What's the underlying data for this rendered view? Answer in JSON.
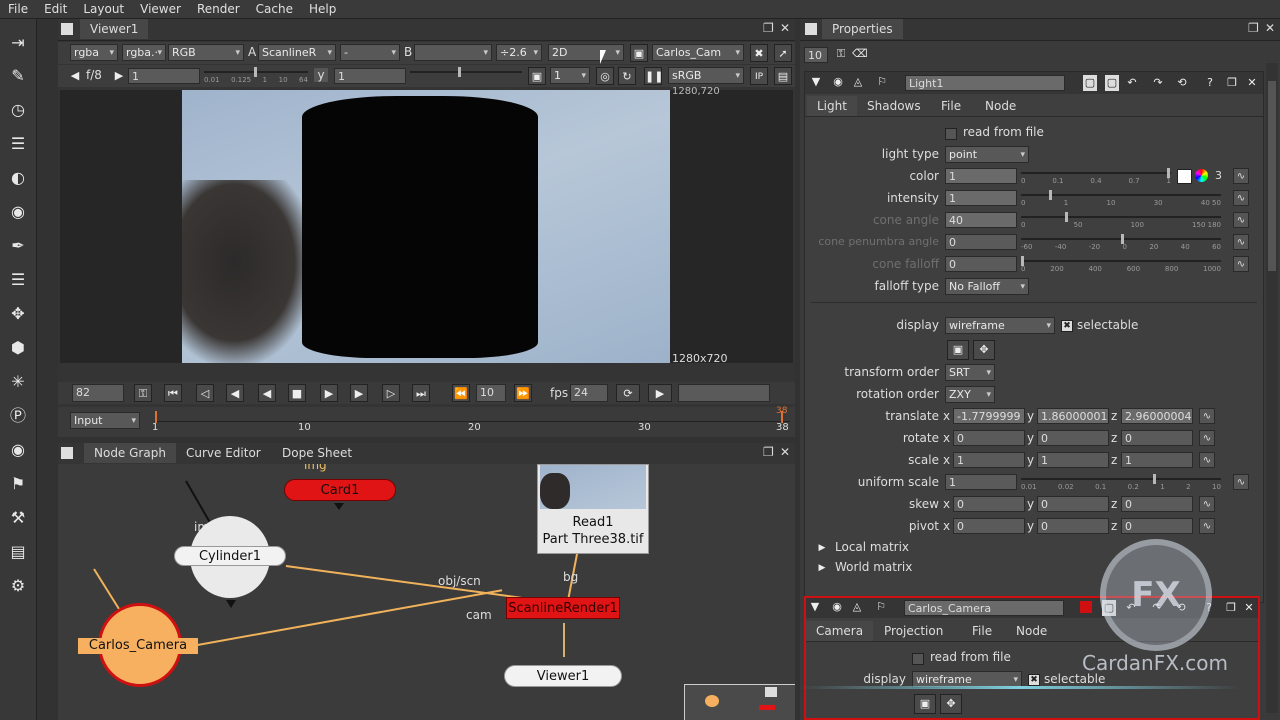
{
  "menu": [
    "File",
    "Edit",
    "Layout",
    "Viewer",
    "Render",
    "Cache",
    "Help"
  ],
  "viewer": {
    "tab": "Viewer1",
    "row1": {
      "channels": "rgba",
      "alpha": "rgba.·",
      "colorspace": "RGB",
      "a_label": "A",
      "a_input": "ScanlineR",
      "wipe": "-",
      "b_label": "B",
      "b_input": "",
      "gain": "÷2.6",
      "mode": "2D",
      "camera": "Carlos_Cam"
    },
    "row2": {
      "fstop": "f/8",
      "gain_value": "1",
      "gain_ticks": [
        "0.01",
        "0.125",
        "1",
        "10",
        "64"
      ],
      "y_label": "y",
      "gamma_value": "1",
      "proxy": "1",
      "lut": "sRGB",
      "ip": "IP"
    },
    "res_top": "1280,720",
    "res_bottom": "1280x720"
  },
  "playback": {
    "frame": "82",
    "step": "10",
    "fps_label": "fps",
    "fps": "24",
    "input": "Input",
    "ruler_start": "1",
    "ruler_labels": [
      "1",
      "10",
      "20",
      "30",
      "38"
    ],
    "ruler_end_top": "38"
  },
  "nodegraph": {
    "tabs": [
      "Node Graph",
      "Curve Editor",
      "Dope Sheet"
    ],
    "nodes": {
      "card": "Card1",
      "cylinder": "Cylinder1",
      "camera": "Carlos_Camera",
      "read": "Read1",
      "read_file": "Part Three38.tif",
      "scanline": "ScanlineRender1",
      "viewer": "Viewer1"
    },
    "edge_labels": {
      "img": "img",
      "obj": "obj/scn",
      "cam": "cam",
      "bg": "bg",
      "img2": "img"
    }
  },
  "properties": {
    "title": "Properties",
    "max_panels": "10",
    "light": {
      "name": "Light1",
      "tabs": [
        "Light",
        "Shadows",
        "File",
        "Node"
      ],
      "read_from_file": "read from file",
      "light_type_label": "light type",
      "light_type": "point",
      "color_label": "color",
      "color": "1",
      "color_ticks": [
        "0",
        "0.1",
        "0.4",
        "0.7",
        "1"
      ],
      "channels": "3",
      "intensity_label": "intensity",
      "intensity": "1",
      "intensity_ticks": [
        "0",
        "1",
        "10",
        "30",
        "40 50"
      ],
      "cone_angle_label": "cone angle",
      "cone_angle": "40",
      "cone_angle_ticks": [
        "0",
        "50",
        "100",
        "150 180"
      ],
      "cone_penumbra_label": "cone penumbra angle",
      "cone_penumbra": "0",
      "cone_penumbra_ticks": [
        "-60",
        "-40",
        "-20",
        "0",
        "20",
        "40",
        "60"
      ],
      "cone_falloff_label": "cone falloff",
      "cone_falloff": "0",
      "cone_falloff_ticks": [
        "0",
        "200",
        "400",
        "600",
        "800",
        "1000"
      ],
      "falloff_type_label": "falloff type",
      "falloff_type": "No Falloff",
      "display_label": "display",
      "display": "wireframe",
      "selectable": "selectable",
      "transform_order_label": "transform order",
      "transform_order": "SRT",
      "rotation_order_label": "rotation order",
      "rotation_order": "ZXY",
      "translate_label": "translate",
      "translate": {
        "x": "-1.7799999",
        "y": "1.86000001",
        "z": "2.96000004"
      },
      "rotate_label": "rotate",
      "rotate": {
        "x": "0",
        "y": "0",
        "z": "0"
      },
      "scale_label": "scale",
      "scale": {
        "x": "1",
        "y": "1",
        "z": "1"
      },
      "uniform_scale_label": "uniform scale",
      "uniform_scale": "1",
      "uniform_ticks": [
        "0.01",
        "0.02",
        "0.1",
        "0.2",
        "1",
        "2",
        "10"
      ],
      "skew_label": "skew",
      "skew": {
        "x": "0",
        "y": "0",
        "z": "0"
      },
      "pivot_label": "pivot",
      "pivot": {
        "x": "0",
        "y": "0",
        "z": "0"
      },
      "local_matrix": "Local matrix",
      "world_matrix": "World matrix"
    },
    "camera": {
      "name": "Carlos_Camera",
      "tabs": [
        "Camera",
        "Projection",
        "File",
        "Node"
      ],
      "read_from_file": "read from file",
      "display_label": "display",
      "display": "wireframe",
      "selectable": "selectable"
    }
  },
  "axis_letters": {
    "x": "x",
    "y": "y",
    "z": "z"
  },
  "watermark": {
    "logo": "FX",
    "site": "CardanFX.com"
  }
}
